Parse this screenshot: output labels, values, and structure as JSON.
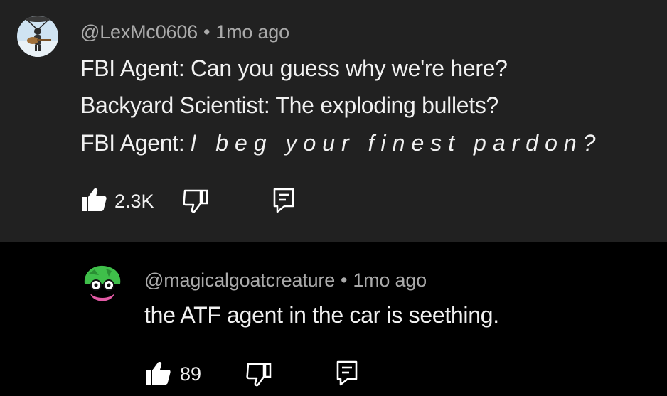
{
  "comments": [
    {
      "author": "@LexMc0606",
      "separator": "•",
      "time": "1mo ago",
      "lines": [
        {
          "text": "FBI Agent: Can you guess why we're here?"
        },
        {
          "text": "Backyard Scientist: The exploding bullets?"
        },
        {
          "prefix": "FBI Agent:",
          "italic": "I beg your finest pardon?"
        }
      ],
      "likes": "2.3K",
      "icons": {
        "like": "thumbs-up-icon",
        "dislike": "thumbs-down-icon",
        "reply": "reply-comment-icon"
      }
    },
    {
      "author": "@magicalgoatcreature",
      "separator": "•",
      "time": "1mo ago",
      "text": "the ATF agent in the car is seething.",
      "likes": "89",
      "icons": {
        "like": "thumbs-up-icon",
        "dislike": "thumbs-down-icon",
        "reply": "reply-comment-icon"
      }
    }
  ],
  "colors": {
    "top_background": "#212121",
    "reply_background": "#000000",
    "meta_text": "#aaaaaa",
    "body_text": "#f1f1f1"
  }
}
